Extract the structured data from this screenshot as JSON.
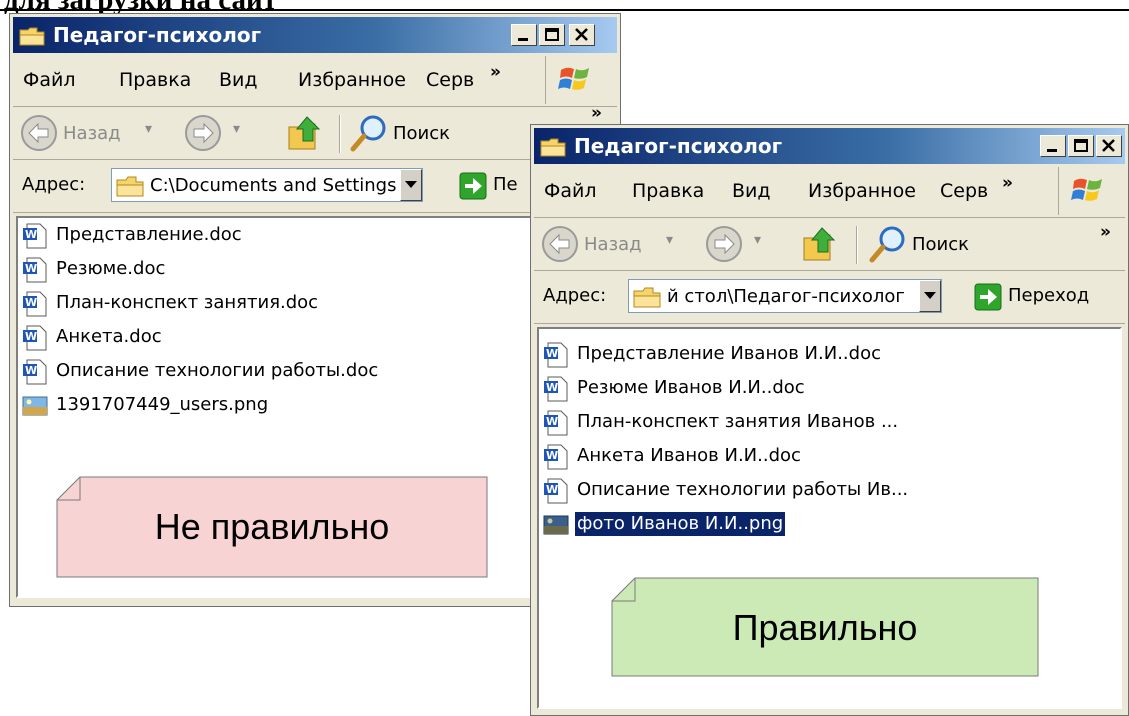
{
  "heading": {
    "text": "для загрузки на сайт"
  },
  "colors": {
    "wrong_note": "#f8d3d4",
    "right_note": "#cceab5",
    "selection": "#0a246a",
    "title_gradient_start": "#0a246a",
    "title_gradient_end": "#a6caf0"
  },
  "windows": [
    {
      "title": "Педагог-психолог",
      "menu": [
        "Файл",
        "Правка",
        "Вид",
        "Избранное",
        "Серв"
      ],
      "menu_more": "»",
      "toolbar": {
        "back": "Назад",
        "search": "Поиск",
        "more": "»"
      },
      "address": {
        "label": "Адрес:",
        "value": "C:\\Documents and Settings",
        "go": "Пе"
      },
      "files": [
        {
          "name": "Представление.doc",
          "icon": "word-doc-icon"
        },
        {
          "name": "Резюме.doc",
          "icon": "word-doc-icon"
        },
        {
          "name": "План-конспект занятия.doc",
          "icon": "word-doc-icon"
        },
        {
          "name": "Анкета.doc",
          "icon": "word-doc-icon"
        },
        {
          "name": "Описание технологии работы.doc",
          "icon": "word-doc-icon"
        },
        {
          "name": "1391707449_users.png",
          "icon": "image-file-icon"
        }
      ],
      "note": "Не правильно"
    },
    {
      "title": "Педагог-психолог",
      "menu": [
        "Файл",
        "Правка",
        "Вид",
        "Избранное",
        "Серв"
      ],
      "menu_more": "»",
      "toolbar": {
        "back": "Назад",
        "search": "Поиск",
        "more": "»"
      },
      "address": {
        "label": "Адрес:",
        "value": "й стол\\Педагог-психолог",
        "go": "Переход"
      },
      "files": [
        {
          "name": "Представление Иванов И.И..doc",
          "icon": "word-doc-icon"
        },
        {
          "name": "Резюме Иванов И.И..doc",
          "icon": "word-doc-icon"
        },
        {
          "name": "План-конспект занятия Иванов ...",
          "icon": "word-doc-icon"
        },
        {
          "name": "Анкета Иванов И.И..doc",
          "icon": "word-doc-icon"
        },
        {
          "name": "Описание технологии работы Ив...",
          "icon": "word-doc-icon"
        },
        {
          "name": "фото Иванов И.И..png",
          "icon": "image-file-icon",
          "selected": true
        }
      ],
      "note": "Правильно"
    }
  ]
}
